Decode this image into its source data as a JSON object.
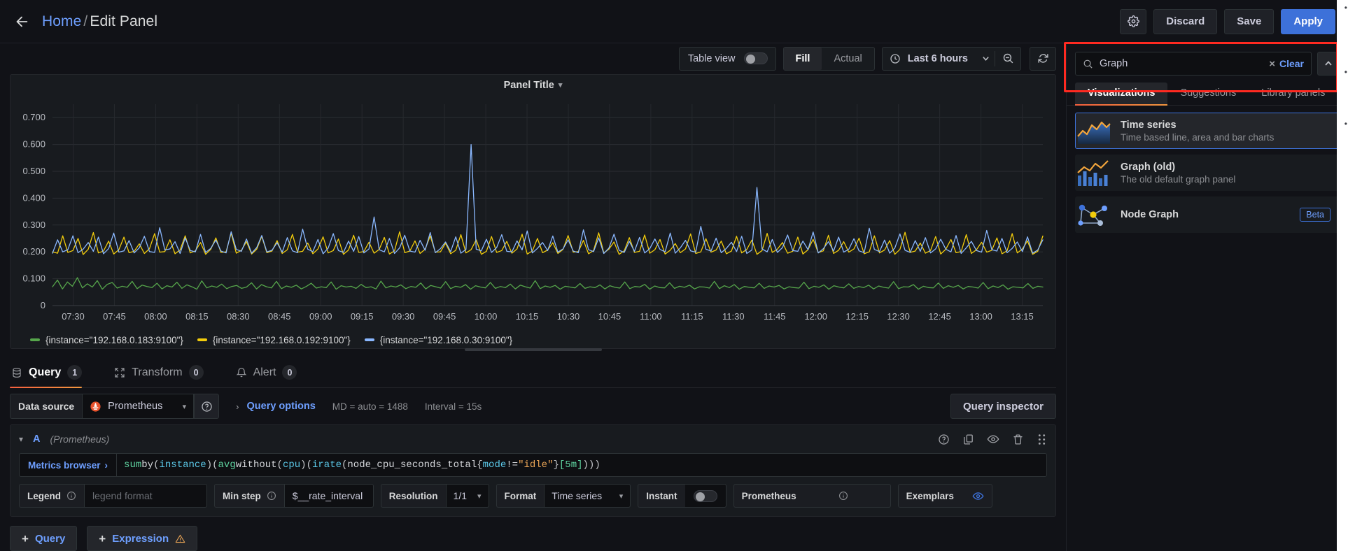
{
  "topnav": {
    "back_icon": "arrow-left-icon",
    "breadcrumb_home": "Home",
    "breadcrumb_sep": "/",
    "breadcrumb_current": "Edit Panel",
    "settings_icon": "gear-icon",
    "discard_label": "Discard",
    "save_label": "Save",
    "apply_label": "Apply"
  },
  "panel_toolbar": {
    "table_view_label": "Table view",
    "table_view_on": false,
    "fill_label": "Fill",
    "actual_label": "Actual",
    "fill_active": true,
    "time_range_label": "Last 6 hours",
    "clock_icon": "clock-icon",
    "chevron_icon": "chevron-down-icon",
    "zoom_out_icon": "zoom-out-icon",
    "refresh_icon": "refresh-icon"
  },
  "panel": {
    "title": "Panel Title",
    "title_chevron": "chevron-down-icon"
  },
  "chart_data": {
    "type": "line",
    "title": "Panel Title",
    "xlabel": "",
    "ylabel": "",
    "ylim": [
      0,
      0.75
    ],
    "grid": true,
    "legend_position": "bottom",
    "ytick_labels": [
      "0.700",
      "0.600",
      "0.500",
      "0.400",
      "0.300",
      "0.200",
      "0.100",
      "0"
    ],
    "ytick_values": [
      0.7,
      0.6,
      0.5,
      0.4,
      0.3,
      0.2,
      0.1,
      0
    ],
    "xtick_labels": [
      "07:30",
      "07:45",
      "08:00",
      "08:15",
      "08:30",
      "08:45",
      "09:00",
      "09:15",
      "09:30",
      "09:45",
      "10:00",
      "10:15",
      "10:30",
      "10:45",
      "11:00",
      "11:15",
      "11:30",
      "11:45",
      "12:00",
      "12:15",
      "12:30",
      "12:45",
      "13:00",
      "13:15"
    ],
    "series": [
      {
        "name": "{instance=\"192.168.0.183:9100\"}",
        "color": "#56a64b",
        "mean": 0.075,
        "values": [
          0.07,
          0.095,
          0.062,
          0.088,
          0.072,
          0.104,
          0.066,
          0.081,
          0.069,
          0.093,
          0.061,
          0.079,
          0.086,
          0.065,
          0.072,
          0.068,
          0.09,
          0.063,
          0.076,
          0.071,
          0.067,
          0.083,
          0.062,
          0.074,
          0.069,
          0.087,
          0.064,
          0.077,
          0.07,
          0.061,
          0.092,
          0.066,
          0.073,
          0.068,
          0.08,
          0.063,
          0.071,
          0.075,
          0.064,
          0.069,
          0.085,
          0.062,
          0.078,
          0.07,
          0.066,
          0.09,
          0.063,
          0.073,
          0.068,
          0.076,
          0.062,
          0.071,
          0.083,
          0.065,
          0.07,
          0.067,
          0.088,
          0.061,
          0.074,
          0.069,
          0.072,
          0.064,
          0.079,
          0.067,
          0.07,
          0.062,
          0.091,
          0.066,
          0.073,
          0.069,
          0.077,
          0.063,
          0.071,
          0.068,
          0.084,
          0.062,
          0.075,
          0.07,
          0.065,
          0.089,
          0.063,
          0.072,
          0.068,
          0.078,
          0.061,
          0.074,
          0.069,
          0.066,
          0.086,
          0.064,
          0.071,
          0.067,
          0.08,
          0.062,
          0.076,
          0.07,
          0.065,
          0.093,
          0.063,
          0.073,
          0.068,
          0.075,
          0.061,
          0.072,
          0.069,
          0.066,
          0.082,
          0.064,
          0.07,
          0.067,
          0.077,
          0.062,
          0.074,
          0.068,
          0.065,
          0.088,
          0.063,
          0.071,
          0.069,
          0.079,
          0.061,
          0.073,
          0.067,
          0.066,
          0.085,
          0.064,
          0.072,
          0.068,
          0.076,
          0.062,
          0.07,
          0.069,
          0.065,
          0.09,
          0.063,
          0.074,
          0.067,
          0.078,
          0.061,
          0.071,
          0.068,
          0.066,
          0.083,
          0.064,
          0.073,
          0.069,
          0.075,
          0.062,
          0.07,
          0.067,
          0.065,
          0.087,
          0.063,
          0.072,
          0.068,
          0.077,
          0.061,
          0.074,
          0.069,
          0.066,
          0.081,
          0.064,
          0.071,
          0.067,
          0.076,
          0.062,
          0.073,
          0.068,
          0.065,
          0.089,
          0.063,
          0.07,
          0.069,
          0.078,
          0.061,
          0.072,
          0.067,
          0.066,
          0.084,
          0.064,
          0.074,
          0.068,
          0.075,
          0.062,
          0.071,
          0.069,
          0.065,
          0.086,
          0.063,
          0.073,
          0.067,
          0.077,
          0.061,
          0.07,
          0.068,
          0.066,
          0.082,
          0.064,
          0.072,
          0.069
        ]
      },
      {
        "name": "{instance=\"192.168.0.192:9100\"}",
        "color": "#f2cc0c",
        "mean": 0.205,
        "values": [
          0.2,
          0.195,
          0.26,
          0.198,
          0.205,
          0.25,
          0.19,
          0.21,
          0.272,
          0.196,
          0.203,
          0.24,
          0.192,
          0.208,
          0.255,
          0.197,
          0.202,
          0.23,
          0.194,
          0.212,
          0.268,
          0.199,
          0.201,
          0.245,
          0.193,
          0.207,
          0.26,
          0.196,
          0.204,
          0.235,
          0.191,
          0.209,
          0.252,
          0.198,
          0.2,
          0.27,
          0.195,
          0.206,
          0.238,
          0.192,
          0.21,
          0.258,
          0.197,
          0.203,
          0.242,
          0.194,
          0.208,
          0.265,
          0.199,
          0.202,
          0.233,
          0.193,
          0.211,
          0.256,
          0.196,
          0.205,
          0.248,
          0.191,
          0.207,
          0.262,
          0.198,
          0.201,
          0.236,
          0.195,
          0.209,
          0.254,
          0.192,
          0.204,
          0.275,
          0.197,
          0.203,
          0.241,
          0.194,
          0.21,
          0.259,
          0.199,
          0.2,
          0.232,
          0.193,
          0.206,
          0.264,
          0.196,
          0.208,
          0.245,
          0.191,
          0.202,
          0.257,
          0.198,
          0.205,
          0.239,
          0.195,
          0.211,
          0.266,
          0.192,
          0.203,
          0.25,
          0.197,
          0.207,
          0.234,
          0.194,
          0.209,
          0.261,
          0.199,
          0.201,
          0.243,
          0.193,
          0.205,
          0.271,
          0.196,
          0.21,
          0.237,
          0.191,
          0.204,
          0.253,
          0.198,
          0.202,
          0.263,
          0.195,
          0.208,
          0.246,
          0.192,
          0.206,
          0.231,
          0.197,
          0.211,
          0.267,
          0.194,
          0.2,
          0.249,
          0.199,
          0.207,
          0.24,
          0.193,
          0.203,
          0.258,
          0.196,
          0.209,
          0.244,
          0.191,
          0.205,
          0.269,
          0.198,
          0.21,
          0.235,
          0.195,
          0.202,
          0.255,
          0.192,
          0.208,
          0.247,
          0.197,
          0.204,
          0.262,
          0.194,
          0.206,
          0.238,
          0.199,
          0.211,
          0.251,
          0.193,
          0.2,
          0.26,
          0.196,
          0.207,
          0.242,
          0.191,
          0.209,
          0.273,
          0.198,
          0.203,
          0.233,
          0.195,
          0.205,
          0.257,
          0.192,
          0.21,
          0.246,
          0.197,
          0.201,
          0.264,
          0.194,
          0.208,
          0.236,
          0.199,
          0.206,
          0.252,
          0.193,
          0.204,
          0.268,
          0.196,
          0.211,
          0.241,
          0.191,
          0.202,
          0.259
        ]
      },
      {
        "name": "{instance=\"192.168.0.30:9100\"}",
        "color": "#8ab8ff",
        "mean": 0.21,
        "values": [
          0.195,
          0.245,
          0.2,
          0.208,
          0.26,
          0.197,
          0.21,
          0.235,
          0.202,
          0.255,
          0.193,
          0.212,
          0.27,
          0.199,
          0.204,
          0.242,
          0.196,
          0.215,
          0.258,
          0.201,
          0.198,
          0.29,
          0.207,
          0.211,
          0.238,
          0.194,
          0.252,
          0.205,
          0.2,
          0.265,
          0.198,
          0.213,
          0.244,
          0.203,
          0.196,
          0.275,
          0.209,
          0.202,
          0.248,
          0.195,
          0.216,
          0.261,
          0.2,
          0.206,
          0.234,
          0.199,
          0.253,
          0.204,
          0.197,
          0.285,
          0.21,
          0.201,
          0.246,
          0.193,
          0.214,
          0.268,
          0.205,
          0.198,
          0.24,
          0.202,
          0.257,
          0.196,
          0.211,
          0.33,
          0.208,
          0.2,
          0.25,
          0.194,
          0.215,
          0.262,
          0.203,
          0.199,
          0.243,
          0.206,
          0.272,
          0.197,
          0.212,
          0.237,
          0.201,
          0.256,
          0.195,
          0.209,
          0.6,
          0.21,
          0.204,
          0.247,
          0.198,
          0.216,
          0.264,
          0.202,
          0.2,
          0.241,
          0.207,
          0.278,
          0.196,
          0.213,
          0.235,
          0.205,
          0.259,
          0.199,
          0.211,
          0.245,
          0.203,
          0.197,
          0.282,
          0.208,
          0.201,
          0.252,
          0.194,
          0.214,
          0.266,
          0.206,
          0.198,
          0.239,
          0.202,
          0.254,
          0.196,
          0.212,
          0.248,
          0.209,
          0.2,
          0.27,
          0.195,
          0.215,
          0.243,
          0.204,
          0.199,
          0.295,
          0.21,
          0.203,
          0.251,
          0.197,
          0.213,
          0.236,
          0.201,
          0.258,
          0.194,
          0.207,
          0.44,
          0.211,
          0.2,
          0.246,
          0.198,
          0.216,
          0.263,
          0.205,
          0.202,
          0.24,
          0.208,
          0.274,
          0.196,
          0.212,
          0.238,
          0.203,
          0.255,
          0.199,
          0.21,
          0.249,
          0.204,
          0.197,
          0.288,
          0.209,
          0.201,
          0.244,
          0.195,
          0.214,
          0.267,
          0.206,
          0.198,
          0.242,
          0.202,
          0.253,
          0.196,
          0.211,
          0.247,
          0.21,
          0.2,
          0.261,
          0.194,
          0.215,
          0.239,
          0.205,
          0.199,
          0.28,
          0.208,
          0.203,
          0.25,
          0.197,
          0.213,
          0.237,
          0.201,
          0.256,
          0.195,
          0.207,
          0.245
        ]
      }
    ]
  },
  "query_tabs": [
    {
      "label": "Query",
      "count": "1",
      "icon": "database-icon",
      "active": true
    },
    {
      "label": "Transform",
      "count": "0",
      "icon": "transform-icon",
      "active": false
    },
    {
      "label": "Alert",
      "count": "0",
      "icon": "bell-icon",
      "active": false
    }
  ],
  "datasource_row": {
    "label": "Data source",
    "value": "Prometheus",
    "logo": "prometheus-logo",
    "help_icon": "help-circle-icon",
    "query_options_label": "Query options",
    "caret_icon": "chevron-right-icon",
    "max_data_points": "MD = auto = 1488",
    "interval": "Interval = 15s",
    "query_inspector_label": "Query inspector"
  },
  "query_a": {
    "ref_id": "A",
    "datasource": "(Prometheus)",
    "collapse_icon": "chevron-down-icon",
    "actions": [
      "help-circle-icon",
      "copy-icon",
      "eye-icon",
      "trash-icon",
      "drag-handle-icon"
    ],
    "metrics_browser_label": "Metrics browser",
    "metrics_browser_caret": "›",
    "expression": "sum by(instance) (avg without(cpu) (irate(node_cpu_seconds_total{mode!=\"idle\"}[5m])))",
    "expr_tokens": [
      {
        "t": "sum",
        "c": "fn"
      },
      {
        "t": " by",
        "c": "op"
      },
      {
        "t": "(",
        "c": "paren"
      },
      {
        "t": "instance",
        "c": "arg"
      },
      {
        "t": ")",
        "c": "paren"
      },
      {
        "t": " ",
        "c": "op"
      },
      {
        "t": "(",
        "c": "paren"
      },
      {
        "t": "avg",
        "c": "fn"
      },
      {
        "t": " without",
        "c": "op"
      },
      {
        "t": "(",
        "c": "paren"
      },
      {
        "t": "cpu",
        "c": "arg"
      },
      {
        "t": ")",
        "c": "paren"
      },
      {
        "t": " ",
        "c": "op"
      },
      {
        "t": "(",
        "c": "paren"
      },
      {
        "t": "irate",
        "c": "arg"
      },
      {
        "t": "(",
        "c": "paren"
      },
      {
        "t": "node_cpu_seconds_total",
        "c": "metric"
      },
      {
        "t": "{",
        "c": "paren"
      },
      {
        "t": "mode",
        "c": "label"
      },
      {
        "t": "!=",
        "c": "op"
      },
      {
        "t": "\"idle\"",
        "c": "str"
      },
      {
        "t": "}",
        "c": "paren"
      },
      {
        "t": "[5m]",
        "c": "dur"
      },
      {
        "t": ")))",
        "c": "paren"
      }
    ],
    "options": {
      "legend_label": "Legend",
      "legend_placeholder": "legend format",
      "legend_value": "",
      "min_step_label": "Min step",
      "min_step_value": "$__rate_interval",
      "resolution_label": "Resolution",
      "resolution_value": "1/1",
      "format_label": "Format",
      "format_value": "Time series",
      "instant_label": "Instant",
      "instant_on": false,
      "prometheus_label": "Prometheus",
      "exemplars_label": "Exemplars",
      "exemplars_icon": "eye-icon",
      "info_icon": "info-circle-icon"
    }
  },
  "add_buttons": [
    {
      "label": "Query",
      "plus": "+",
      "warn": false
    },
    {
      "label": "Expression",
      "plus": "+",
      "warn": true,
      "warn_icon": "warning-triangle-icon"
    }
  ],
  "viz_picker": {
    "search_value": "Graph",
    "search_icon": "search-icon",
    "clear_label": "Clear",
    "clear_x": "×",
    "collapse_icon": "chevron-up-icon",
    "tabs": [
      {
        "label": "Visualizations",
        "active": true
      },
      {
        "label": "Suggestions",
        "active": false
      },
      {
        "label": "Library panels",
        "active": false
      }
    ],
    "items": [
      {
        "name": "Time series",
        "description": "Time based line, area and bar charts",
        "icon": "timeseries-thumb-icon",
        "selected": true,
        "badge": ""
      },
      {
        "name": "Graph (old)",
        "description": "The old default graph panel",
        "icon": "graph-old-thumb-icon",
        "selected": false,
        "badge": ""
      },
      {
        "name": "Node Graph",
        "description": "",
        "icon": "node-graph-thumb-icon",
        "selected": false,
        "badge": "Beta"
      }
    ]
  },
  "colors": {
    "accent_blue": "#3d71d9",
    "link_blue": "#6e9fff",
    "highlight_red": "#ff2a21",
    "series_green": "#56a64b",
    "series_yellow": "#f2cc0c",
    "series_blue": "#8ab8ff",
    "tab_underline": "#f55f3e"
  }
}
